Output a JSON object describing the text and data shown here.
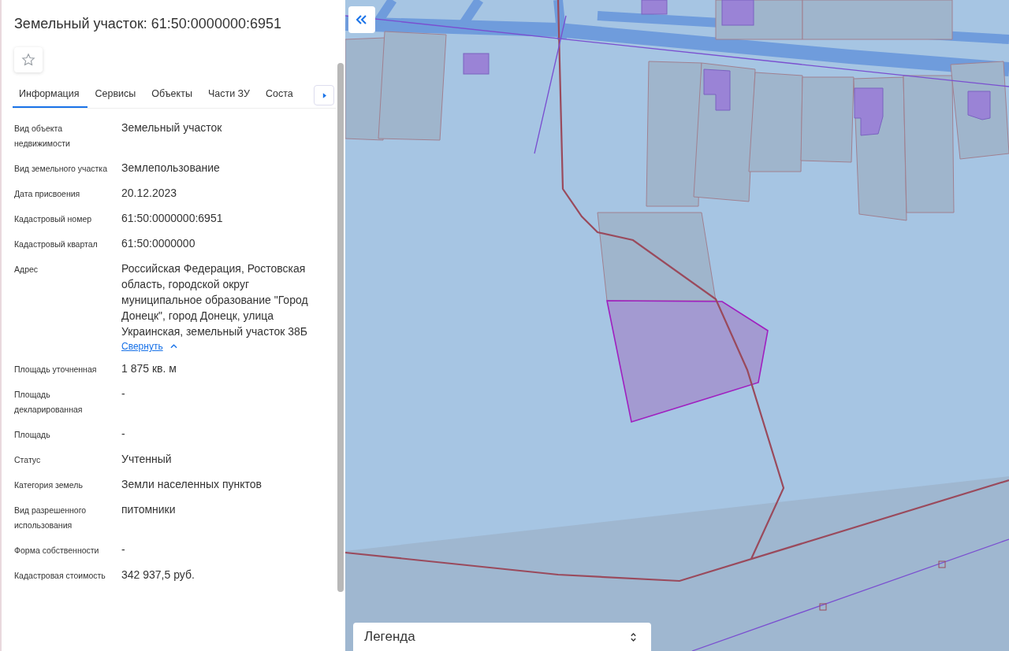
{
  "panel": {
    "title": "Земельный участок: 61:50:0000000:6951",
    "favorite": false,
    "tabs": [
      {
        "label": "Информация",
        "selected": true
      },
      {
        "label": "Сервисы",
        "selected": false
      },
      {
        "label": "Объекты",
        "selected": false
      },
      {
        "label": "Части ЗУ",
        "selected": false
      },
      {
        "label": "Соста",
        "selected": false
      }
    ],
    "fields": [
      {
        "label": "Вид объекта недвижимости",
        "value": "Земельный участок"
      },
      {
        "label": "Вид земельного участка",
        "value": "Землепользование"
      },
      {
        "label": "Дата присвоения",
        "value": "20.12.2023"
      },
      {
        "label": "Кадастровый номер",
        "value": "61:50:0000000:6951"
      },
      {
        "label": "Кадастровый квартал",
        "value": "61:50:0000000"
      },
      {
        "label": "Адрес",
        "value": "Российская Федерация, Ростовская область, городской округ муниципальное образование \"Город Донецк\", город Донецк, улица Украинская, земельный участок 38Б",
        "link": "Свернуть",
        "expanded": true
      },
      {
        "label": "Площадь уточненная",
        "value": "1 875 кв. м"
      },
      {
        "label": "Площадь декларированная",
        "value": "-"
      },
      {
        "label": "Площадь",
        "value": "-"
      },
      {
        "label": "Статус",
        "value": "Учтенный"
      },
      {
        "label": "Категория земель",
        "value": "Земли населенных пунктов"
      },
      {
        "label": "Вид разрешенного использования",
        "value": "питомники"
      },
      {
        "label": "Форма собственности",
        "value": "-"
      },
      {
        "label": "Кадастровая стоимость",
        "value": "342 937,5 руб."
      }
    ]
  },
  "map": {
    "legend": {
      "label": "Легенда"
    }
  }
}
